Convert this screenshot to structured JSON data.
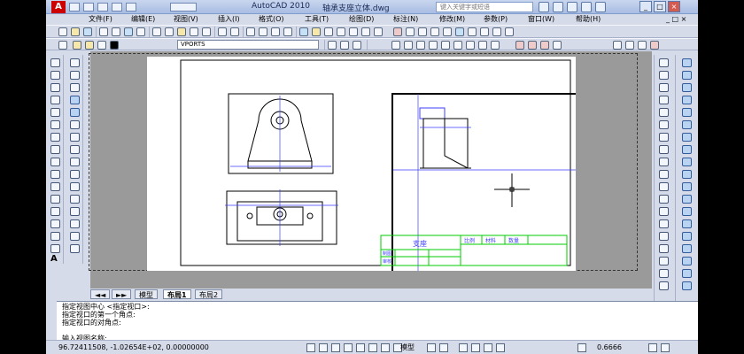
{
  "titlebar": {
    "app_name": "AutoCAD 2010",
    "file_name": "轴承支座立体.dwg",
    "search_placeholder": "键入关键字或短语"
  },
  "menu": [
    "文件(F)",
    "编辑(E)",
    "视图(V)",
    "插入(I)",
    "格式(O)",
    "工具(T)",
    "绘图(D)",
    "标注(N)",
    "修改(M)",
    "参数(P)",
    "窗口(W)",
    "帮助(H)"
  ],
  "layer": {
    "current": "VPORTS"
  },
  "drawing": {
    "title_block": {
      "name": "支座",
      "col_ratio": "比例",
      "col_material": "材料",
      "col_quantity": "数量",
      "row_draw": "制图",
      "row_check": "审核"
    }
  },
  "tabs": [
    "模型",
    "布局1",
    "布局2"
  ],
  "command_lines": [
    "指定视图中心 <指定视口>:",
    "指定视口的第一个角点:",
    "指定视口的对角点:",
    "",
    "输入视图名称:"
  ],
  "status": {
    "coords": "96.72411508,  -1.02654E+02, 0.00000000",
    "space": "模型",
    "zoom": "0.6666"
  },
  "colors": {
    "accent": "#c00000",
    "viewport_frame": "#000000",
    "construction": "#3d3dff",
    "title_block": "#00cc00"
  }
}
